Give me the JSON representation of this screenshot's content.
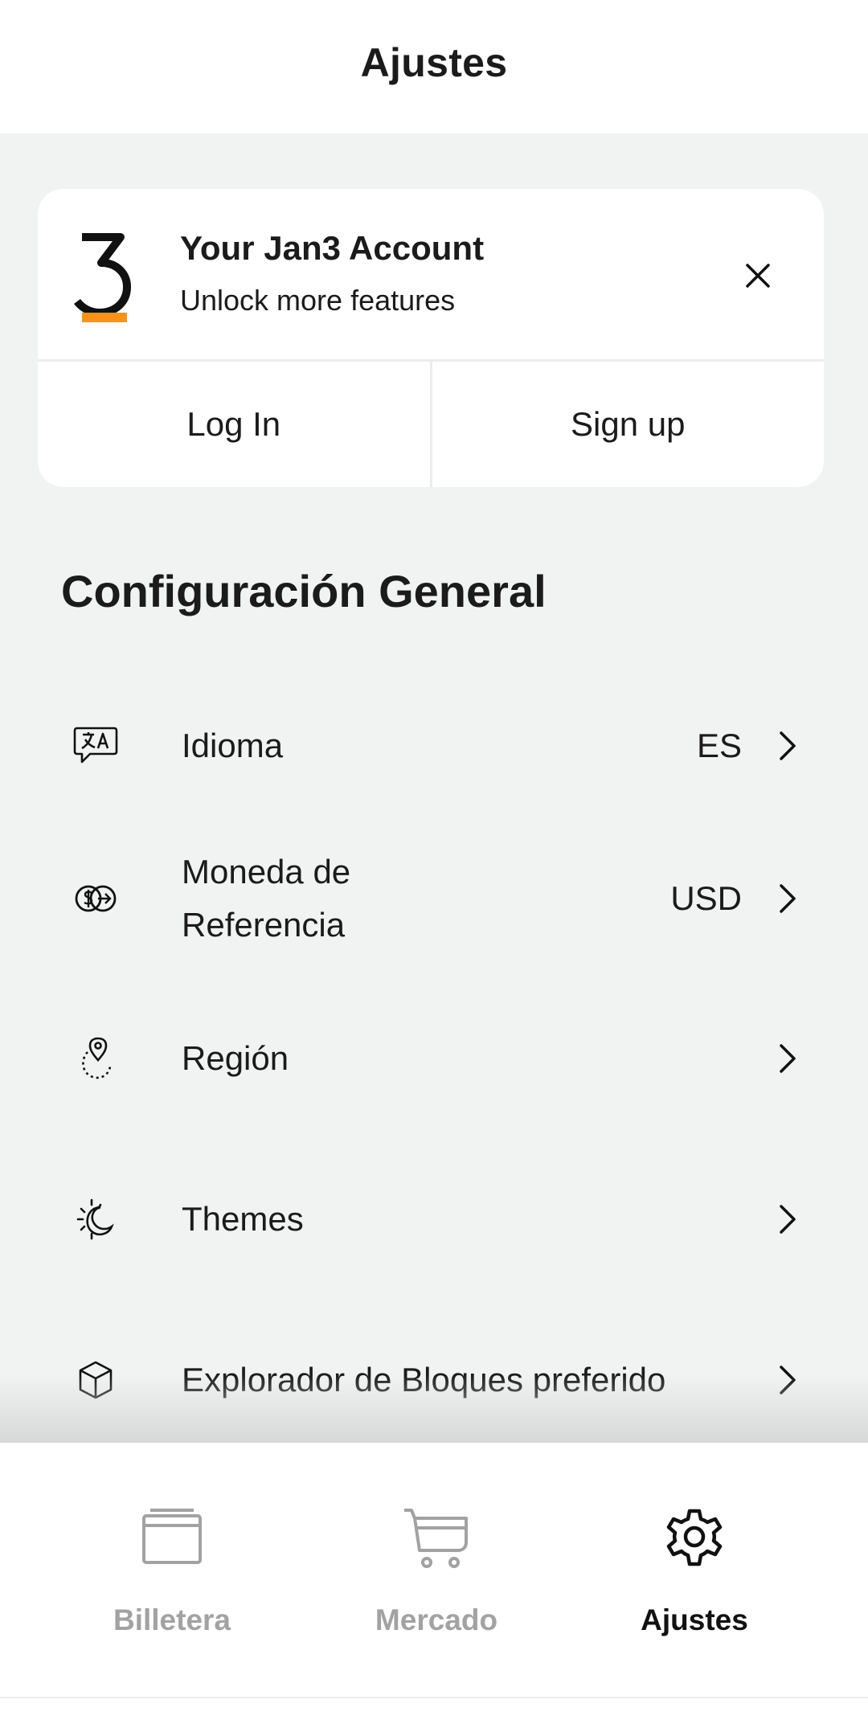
{
  "header": {
    "title": "Ajustes"
  },
  "account_card": {
    "title": "Your Jan3 Account",
    "subtitle": "Unlock more features",
    "login_label": "Log In",
    "signup_label": "Sign up",
    "brand_accent": "#f7931a"
  },
  "section": {
    "title": "Configuración General"
  },
  "settings": [
    {
      "icon": "translate-icon",
      "label": "Idioma",
      "value": "ES"
    },
    {
      "icon": "currency-exchange-icon",
      "label": "Moneda de Referencia",
      "value": "USD"
    },
    {
      "icon": "location-pin-icon",
      "label": "Región",
      "value": ""
    },
    {
      "icon": "sun-moon-icon",
      "label": "Themes",
      "value": ""
    },
    {
      "icon": "cube-icon",
      "label": "Explorador de Bloques preferido",
      "value": ""
    }
  ],
  "tabbar": {
    "tabs": [
      {
        "icon": "wallet-icon",
        "label": "Billetera",
        "active": false
      },
      {
        "icon": "cart-icon",
        "label": "Mercado",
        "active": false
      },
      {
        "icon": "gear-icon",
        "label": "Ajustes",
        "active": true
      }
    ]
  }
}
